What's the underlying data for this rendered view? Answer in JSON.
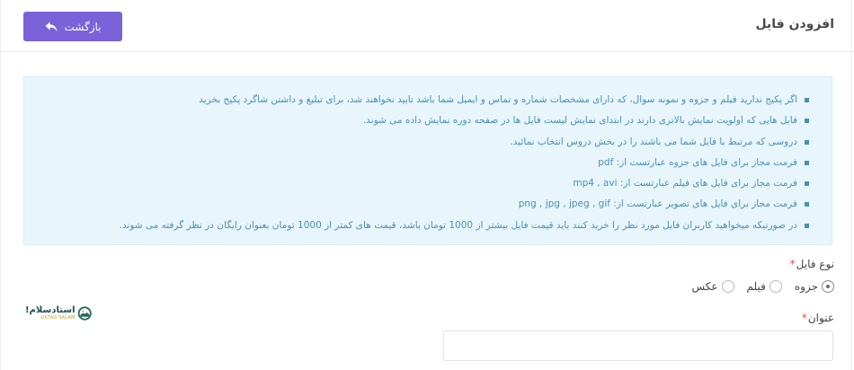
{
  "header": {
    "title": "افزودن فایل",
    "back_label": "بازگشت"
  },
  "info": {
    "items": [
      "اگر پکیج ندارید فیلم و جزوه و نمونه سوال، که دارای مشخصات شماره و تماس و ایمیل شما باشد تایید نخواهند شد، برای تبلیغ و داشتن شاگرد پکیج بخرید",
      "فایل هایی که اولویت نمایش بالاتری دارند در ابتدای نمایش لیست فایل ها در صفحه دوره نمایش داده می شوند.",
      "دروسی که مرتبط با فایل شما می باشند را در بخش دروس انتخاب نمائید.",
      "فرمت مجاز برای فایل های جزوه عبارتست از: pdf",
      "فرمت مجاز برای فایل های فیلم عبارتست از: mp4 , avi",
      "فرمت مجاز برای فایل های تصویر عبارتست از: png , jpg , jpeg , gif",
      "در صورتیکه میخواهید کاربران فایل مورد نظر را خرید کنند باید قیمت فایل بیشتر از 1000 تومان باشد، قیمت های کمتر از 1000 تومان بعنوان رایگان در نظر گرفته می شوند."
    ]
  },
  "form": {
    "file_type": {
      "label": "نوع فایل",
      "required_mark": "*",
      "options": [
        {
          "label": "جزوه",
          "checked": true
        },
        {
          "label": "فیلم",
          "checked": false
        },
        {
          "label": "عکس",
          "checked": false
        }
      ]
    },
    "title": {
      "label": "عنوان",
      "required_mark": "*",
      "value": "",
      "placeholder": ""
    }
  },
  "watermark": {
    "text_fa": "استادسلام!",
    "text_en": "OSTAD SALAM"
  },
  "colors": {
    "accent": "#7a63d8",
    "info_bg": "#e8f6fc",
    "info_text": "#4a8fb5",
    "required": "#e05050"
  }
}
